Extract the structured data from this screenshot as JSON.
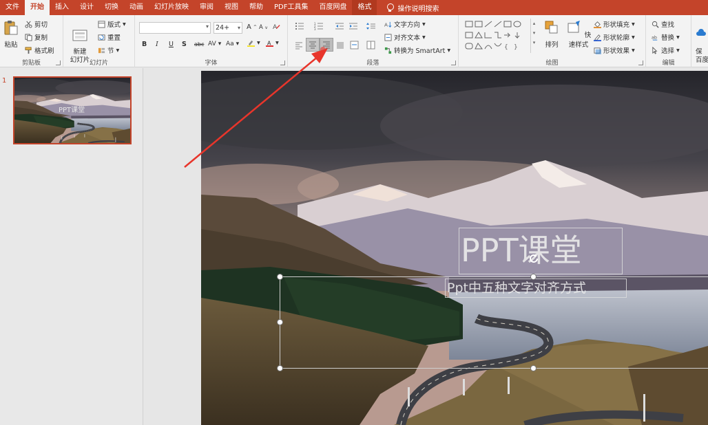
{
  "menu": {
    "tabs": [
      "文件",
      "开始",
      "插入",
      "设计",
      "切换",
      "动画",
      "幻灯片放映",
      "审阅",
      "视图",
      "帮助",
      "PDF工具集",
      "百度网盘",
      "格式"
    ],
    "active_tab": "开始",
    "search_label": "操作说明搜索"
  },
  "ribbon": {
    "clipboard": {
      "label": "剪贴板",
      "paste": "粘贴",
      "cut": "剪切",
      "copy": "复制",
      "format_painter": "格式刷"
    },
    "slides": {
      "label": "幻灯片",
      "new_slide": "新建\n幻灯片",
      "layout": "版式",
      "reset": "重置",
      "section": "节"
    },
    "font": {
      "label": "字体",
      "font_name": "",
      "font_size": "24+",
      "bold": "B",
      "italic": "I",
      "underline": "U",
      "shadow": "S",
      "strike": "abc",
      "spacing": "AV",
      "case": "Aa",
      "grow": "A",
      "shrink": "A"
    },
    "paragraph": {
      "label": "段落",
      "text_direction": "文字方向",
      "align_text": "对齐文本",
      "smartart": "转换为 SmartArt"
    },
    "drawing": {
      "label": "绘图",
      "arrange": "排列",
      "quick_styles": "快速样式",
      "shape_fill": "形状填充",
      "shape_outline": "形状轮廓",
      "shape_effects": "形状效果"
    },
    "editing": {
      "label": "编辑",
      "find": "查找",
      "replace": "替换",
      "select": "选择"
    },
    "save_partial": "保\n百度"
  },
  "thumbnails": [
    {
      "number": "1",
      "title": "PPT课堂"
    }
  ],
  "slide": {
    "title": "PPT课堂",
    "subtitle": "Ppt中五种文字对齐方式"
  },
  "colors": {
    "accent": "#c4442a",
    "ribbon_bg": "#f3f3f3",
    "arrow": "#e8352b"
  }
}
